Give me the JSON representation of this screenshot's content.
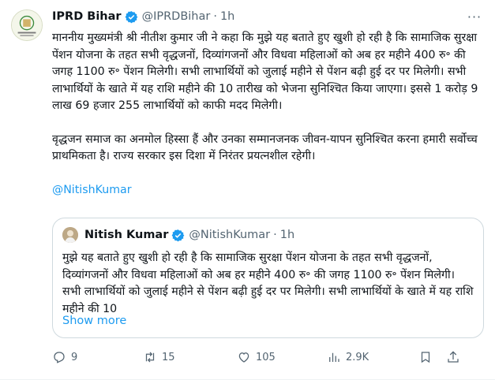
{
  "tweet": {
    "author_name": "IPRD Bihar",
    "author_handle": "@IPRDBihar",
    "separator": "·",
    "time": "1h",
    "more_label": "···",
    "para1": "माननीय मुख्यमंत्री श्री नीतीश कुमार जी ने कहा कि मुझे यह बताते हुए खुशी हो रही है कि सामाजिक सुरक्षा पेंशन योजना के तहत सभी वृद्धजनों, दिव्यांगजनों और विधवा महिलाओं को अब हर महीने 400 रु॰ की जगह 1100 रु॰ पेंशन मिलेगी। सभी लाभार्थियों को जुलाई महीने से पेंशन बढ़ी हुई दर पर मिलेगी। सभी लाभार्थियों के खाते में यह राशि महीने की 10 तारीख को भेजना सुनिश्चित किया जाएगा। इससे 1 करोड़ 9 लाख 69 हजार 255 लाभार्थियों को काफी मदद मिलेगी।",
    "para2": "वृद्धजन समाज का अनमोल हिस्सा हैं और उनका सम्मानजनक जीवन-यापन सुनिश्चित करना हमारी सर्वोच्च प्राथमिकता है। राज्य सरकार इस दिशा में निरंतर प्रयत्नशील रहेगी।",
    "mention": "@NitishKumar"
  },
  "quoted": {
    "author_name": "Nitish Kumar",
    "author_handle": "@NitishKumar",
    "separator": "·",
    "time": "1h",
    "text": "मुझे यह बताते हुए खुशी हो रही है कि सामाजिक सुरक्षा पेंशन योजना के तहत सभी वृद्धजनों, दिव्यांगजनों और विधवा महिलाओं को अब हर महीने 400 रु॰ की जगह 1100 रु॰ पेंशन मिलेगी। सभी लाभार्थियों को जुलाई महीने से पेंशन बढ़ी हुई दर पर मिलेगी। सभी लाभार्थियों के खाते में यह राशि महीने की 10",
    "show_more": "Show more"
  },
  "actions": {
    "replies": "9",
    "reposts": "15",
    "likes": "105",
    "views": "2.9K"
  },
  "icons": {
    "verified": "verified-badge-icon",
    "reply": "reply-icon",
    "repost": "repost-icon",
    "like": "heart-icon",
    "views": "views-chart-icon",
    "bookmark": "bookmark-icon",
    "share": "share-icon"
  },
  "colors": {
    "accent": "#1d9bf0",
    "secondary_text": "#536471",
    "border": "#cfd9de"
  }
}
